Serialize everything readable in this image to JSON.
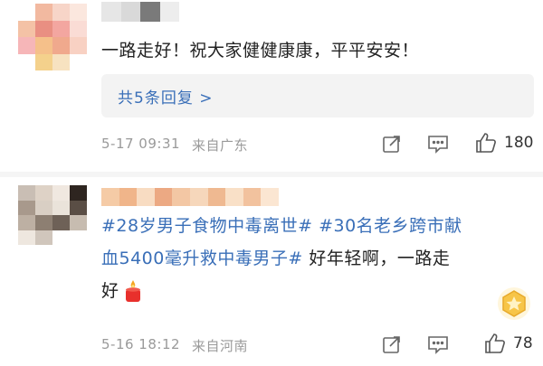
{
  "comments": [
    {
      "avatar_colors": [
        "#ffffff",
        "#f2b9a0",
        "#f7d5c8",
        "#fbe7de",
        "#f4c2a6",
        "#e98f82",
        "#f3a6a0",
        "#fadcd5",
        "#f6b6b8",
        "#f5c08a",
        "#f0a98d",
        "#f8d1c3",
        "#ffffff",
        "#f4d18c",
        "#f7e2c0",
        "#ffffff"
      ],
      "name_colors": [
        "#e6e6e6",
        "#d9d9d9",
        "#7a7a7a",
        "#ededed"
      ],
      "text": "一路走好！祝大家健健康康，平平安安！",
      "replies": "共5条回复 >",
      "time": "5-17 09:31",
      "location": "来自广东",
      "likes": "180"
    },
    {
      "avatar_colors": [
        "#c9beb4",
        "#ded2c6",
        "#f0e8e0",
        "#2e2520",
        "#a8998c",
        "#d9cfc4",
        "#eae3da",
        "#5a4e45",
        "#bdb0a3",
        "#8d7f72",
        "#6e6157",
        "#c7bcb0",
        "#eee7df",
        "#d0c6bc",
        "#ffffff",
        "#ffffff"
      ],
      "name_colors": [
        "#f5cba6",
        "#f0b58a",
        "#f8dcc2",
        "#eca983",
        "#f3c7a4",
        "#f6d7bb",
        "#efb991",
        "#f9e0c7",
        "#f2c29e",
        "#fbe6d2"
      ],
      "tag1": "#28岁男子食物中毒离世#",
      "tag2_line1": "#30名老乡跨市献",
      "tag2_line2": "血5400毫升救中毒男子#",
      "text_line2_tail": "好年轻啊，一路走",
      "text_line3": "好",
      "emoji": "candle",
      "time": "5-16 18:12",
      "location": "来自河南",
      "likes": "78"
    }
  ],
  "colors": {
    "link": "#3a6fb8",
    "meta": "#9a9a9a",
    "reply_bg": "#f3f3f3"
  },
  "icons": [
    "share-icon",
    "comment-icon",
    "like-icon",
    "candle-emoji-icon",
    "badge-icon"
  ]
}
